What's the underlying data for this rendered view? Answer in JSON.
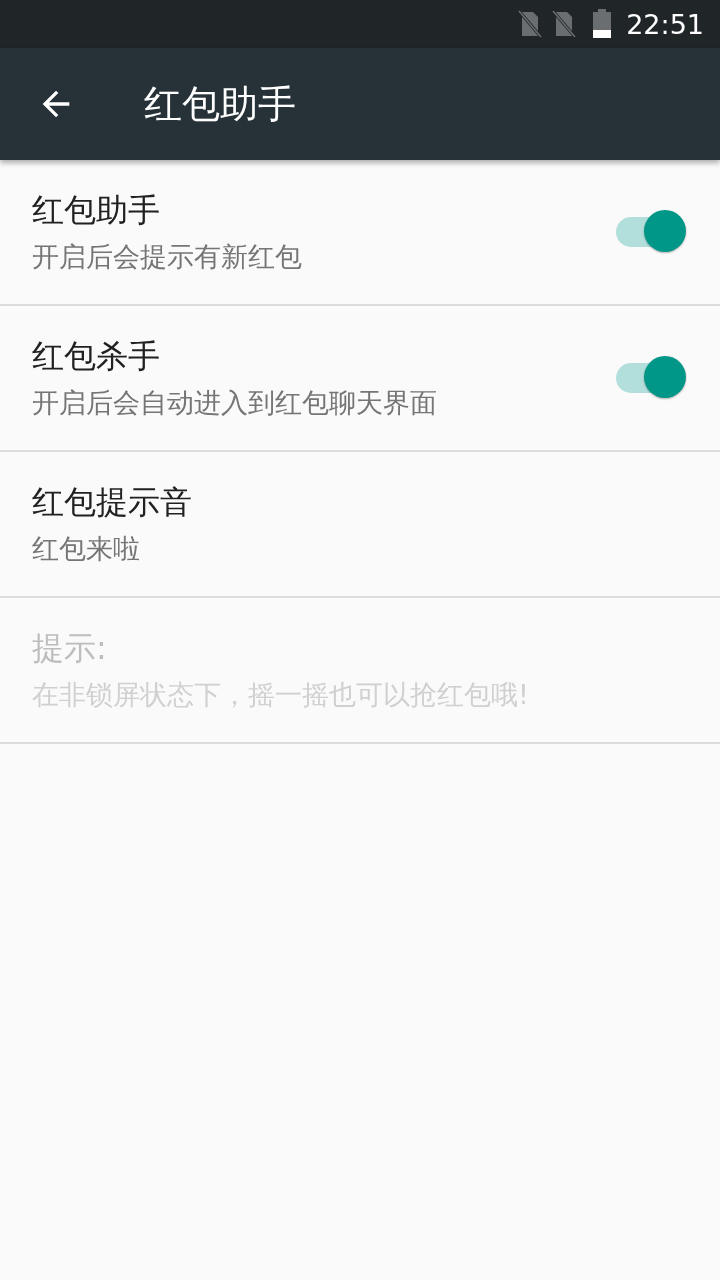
{
  "status_bar": {
    "time": "22:51"
  },
  "toolbar": {
    "title": "红包助手"
  },
  "items": [
    {
      "kind": "switch",
      "title": "红包助手",
      "summary": "开启后会提示有新红包",
      "on": true,
      "disabled": false
    },
    {
      "kind": "switch",
      "title": "红包杀手",
      "summary": "开启后会自动进入到红包聊天界面",
      "on": true,
      "disabled": false
    },
    {
      "kind": "plain",
      "title": "红包提示音",
      "summary": "红包来啦",
      "disabled": false
    },
    {
      "kind": "plain",
      "title": "提示:",
      "summary": "在非锁屏状态下，摇一摇也可以抢红包哦!",
      "disabled": true
    }
  ]
}
